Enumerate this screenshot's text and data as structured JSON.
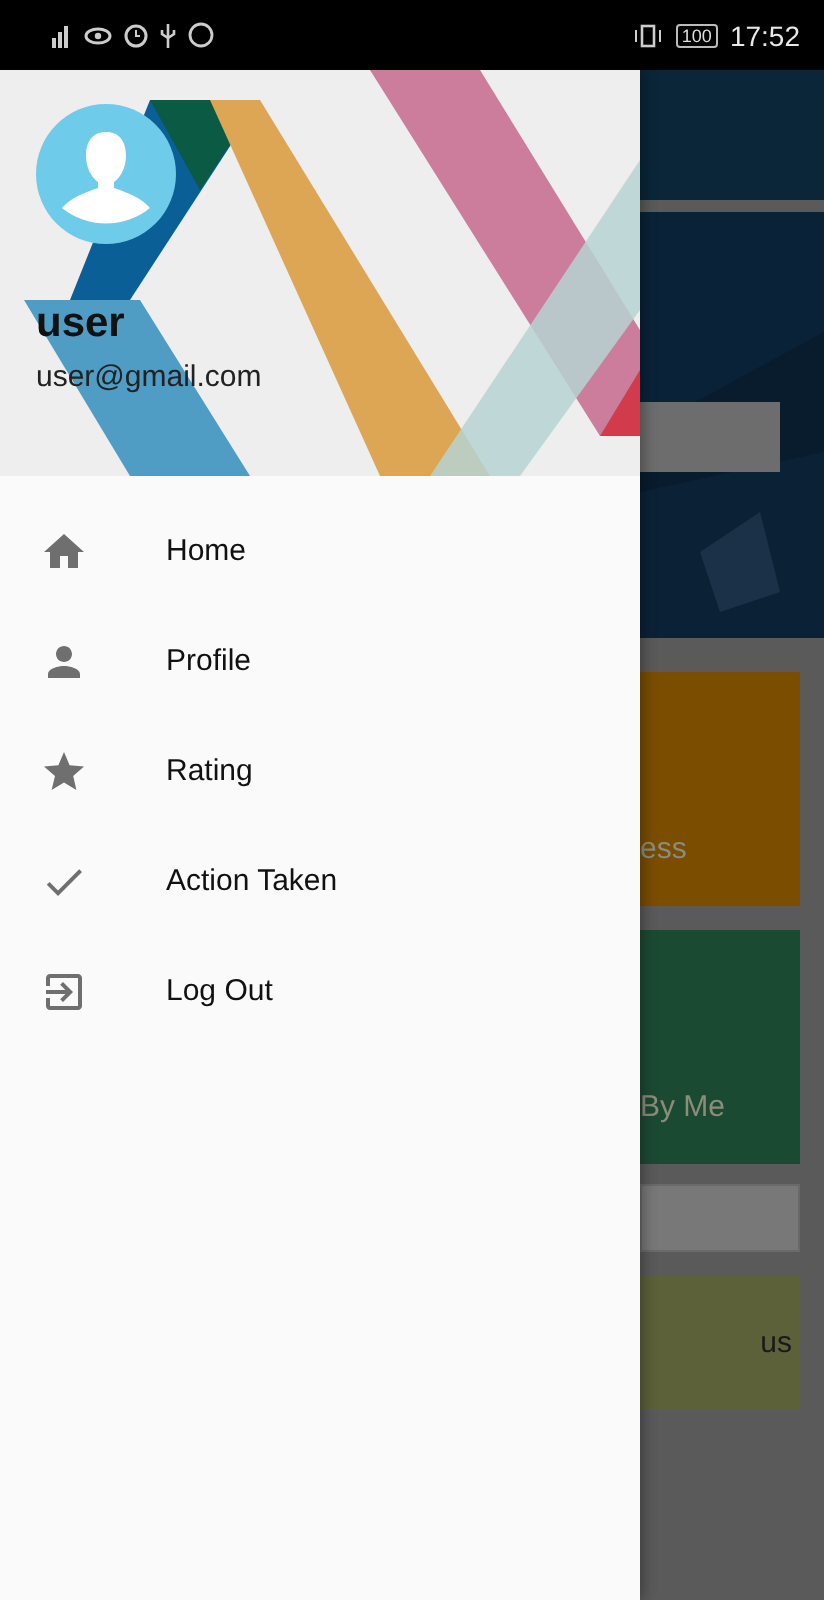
{
  "status_bar": {
    "battery": "100",
    "time": "17:52"
  },
  "drawer": {
    "user_name": "user",
    "email": "user@gmail.com",
    "items": [
      {
        "label": "Home",
        "kind": "home"
      },
      {
        "label": "Profile",
        "kind": "person"
      },
      {
        "label": "Rating",
        "kind": "star"
      },
      {
        "label": "Action Taken",
        "kind": "check"
      },
      {
        "label": "Log Out",
        "kind": "logout"
      }
    ]
  },
  "background": {
    "cards": [
      {
        "label": "ess",
        "color": "#7a4d00"
      },
      {
        "label": "By Me",
        "color": "#1b4a33"
      }
    ],
    "list_item": {
      "text": "us"
    }
  }
}
